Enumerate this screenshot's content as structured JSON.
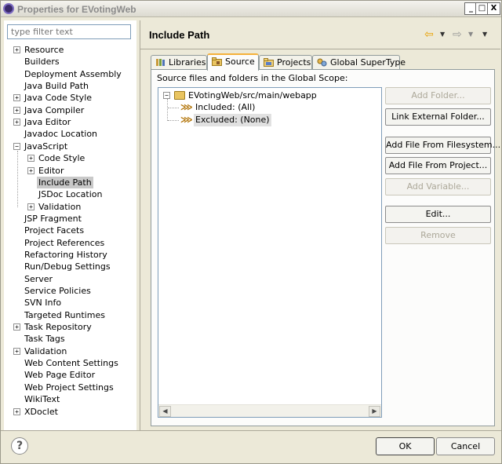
{
  "window": {
    "title": "Properties for EVotingWeb",
    "controls": {
      "minimize": "_",
      "maximize": "□",
      "close": "X"
    }
  },
  "sidebar": {
    "filter_placeholder": "type filter text",
    "items": [
      {
        "label": "Resource",
        "expandable": true,
        "expanded": false,
        "level": 0
      },
      {
        "label": "Builders",
        "expandable": false,
        "level": 0
      },
      {
        "label": "Deployment Assembly",
        "expandable": false,
        "level": 0
      },
      {
        "label": "Java Build Path",
        "expandable": false,
        "level": 0
      },
      {
        "label": "Java Code Style",
        "expandable": true,
        "expanded": false,
        "level": 0
      },
      {
        "label": "Java Compiler",
        "expandable": true,
        "expanded": false,
        "level": 0
      },
      {
        "label": "Java Editor",
        "expandable": true,
        "expanded": false,
        "level": 0
      },
      {
        "label": "Javadoc Location",
        "expandable": false,
        "level": 0
      },
      {
        "label": "JavaScript",
        "expandable": true,
        "expanded": true,
        "level": 0
      },
      {
        "label": "Code Style",
        "expandable": true,
        "expanded": false,
        "level": 1
      },
      {
        "label": "Editor",
        "expandable": true,
        "expanded": false,
        "level": 1
      },
      {
        "label": "Include Path",
        "expandable": false,
        "level": 1,
        "selected": true
      },
      {
        "label": "JSDoc Location",
        "expandable": false,
        "level": 1
      },
      {
        "label": "Validation",
        "expandable": true,
        "expanded": false,
        "level": 1
      },
      {
        "label": "JSP Fragment",
        "expandable": false,
        "level": 0
      },
      {
        "label": "Project Facets",
        "expandable": false,
        "level": 0
      },
      {
        "label": "Project References",
        "expandable": false,
        "level": 0
      },
      {
        "label": "Refactoring History",
        "expandable": false,
        "level": 0
      },
      {
        "label": "Run/Debug Settings",
        "expandable": false,
        "level": 0
      },
      {
        "label": "Server",
        "expandable": false,
        "level": 0
      },
      {
        "label": "Service Policies",
        "expandable": false,
        "level": 0
      },
      {
        "label": "SVN Info",
        "expandable": false,
        "level": 0
      },
      {
        "label": "Targeted Runtimes",
        "expandable": false,
        "level": 0
      },
      {
        "label": "Task Repository",
        "expandable": true,
        "expanded": false,
        "level": 0
      },
      {
        "label": "Task Tags",
        "expandable": false,
        "level": 0
      },
      {
        "label": "Validation",
        "expandable": true,
        "expanded": false,
        "level": 0
      },
      {
        "label": "Web Content Settings",
        "expandable": false,
        "level": 0
      },
      {
        "label": "Web Page Editor",
        "expandable": false,
        "level": 0
      },
      {
        "label": "Web Project Settings",
        "expandable": false,
        "level": 0
      },
      {
        "label": "WikiText",
        "expandable": false,
        "level": 0
      },
      {
        "label": "XDoclet",
        "expandable": true,
        "expanded": false,
        "level": 0
      }
    ]
  },
  "main": {
    "title": "Include Path",
    "nav": {
      "back_icon": "back-arrow-icon",
      "forward_icon": "forward-arrow-icon",
      "menu_icon": "view-menu-icon"
    },
    "tabs": [
      {
        "label": "Libraries",
        "icon": "libraries-icon",
        "active": false
      },
      {
        "label": "Source",
        "icon": "source-folder-icon",
        "active": true
      },
      {
        "label": "Projects",
        "icon": "projects-icon",
        "active": false
      },
      {
        "label": "Global SuperType",
        "icon": "supertype-icon",
        "active": false
      }
    ],
    "panel_label": "Source files and folders in the Global Scope:",
    "source_tree": {
      "root": "EVotingWeb/src/main/webapp",
      "children": [
        {
          "label": "Included: (All)",
          "selected": false
        },
        {
          "label": "Excluded: (None)",
          "selected": true
        }
      ]
    },
    "buttons": [
      {
        "label": "Add Folder...",
        "enabled": false
      },
      {
        "label": "Link External Folder...",
        "enabled": true
      },
      {
        "label": "Add File From Filesystem...",
        "enabled": true
      },
      {
        "label": "Add File From Project...",
        "enabled": true
      },
      {
        "label": "Add Variable...",
        "enabled": false
      },
      {
        "label": "Edit...",
        "enabled": true
      },
      {
        "label": "Remove",
        "enabled": false
      }
    ]
  },
  "footer": {
    "help_label": "?",
    "ok_label": "OK",
    "cancel_label": "Cancel"
  }
}
